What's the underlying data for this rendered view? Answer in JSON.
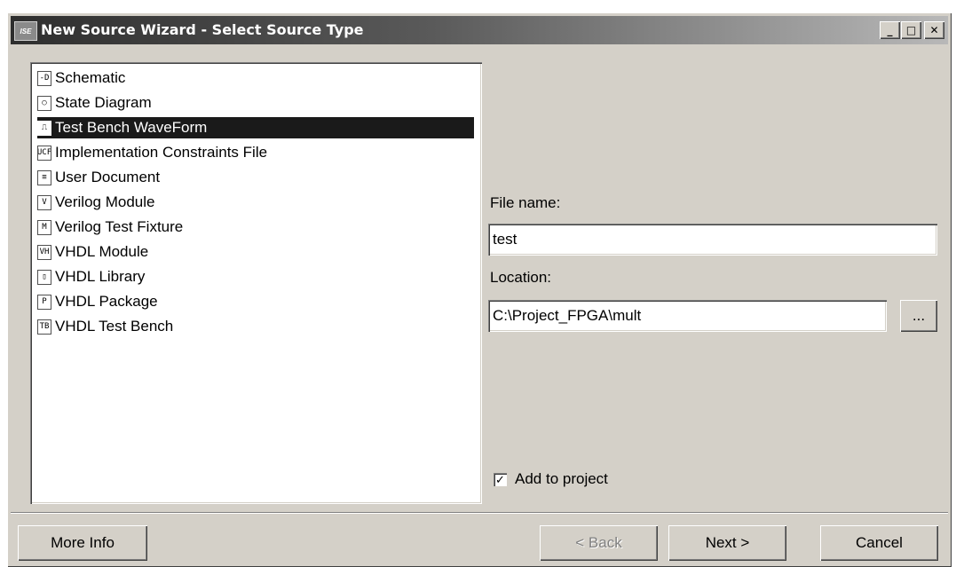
{
  "window": {
    "title": "New Source Wizard - Select Source Type",
    "app_icon_text": "ISE",
    "controls": {
      "minimize": "_",
      "maximize": "□",
      "close": "✕"
    }
  },
  "source_types": [
    {
      "label": "Schematic",
      "icon": "schematic-icon",
      "glyph": "-D",
      "selected": false
    },
    {
      "label": "State Diagram",
      "icon": "state-diagram-icon",
      "glyph": "○",
      "selected": false
    },
    {
      "label": "Test Bench WaveForm",
      "icon": "waveform-icon",
      "glyph": "⎍",
      "selected": true
    },
    {
      "label": "Implementation Constraints File",
      "icon": "constraints-file-icon",
      "glyph": "UCF",
      "selected": false
    },
    {
      "label": "User Document",
      "icon": "document-icon",
      "glyph": "≡",
      "selected": false
    },
    {
      "label": "Verilog Module",
      "icon": "verilog-module-icon",
      "glyph": "V",
      "selected": false
    },
    {
      "label": "Verilog Test Fixture",
      "icon": "verilog-fixture-icon",
      "glyph": "M",
      "selected": false
    },
    {
      "label": "VHDL Module",
      "icon": "vhdl-module-icon",
      "glyph": "VH",
      "selected": false
    },
    {
      "label": "VHDL Library",
      "icon": "vhdl-library-icon",
      "glyph": "▯",
      "selected": false
    },
    {
      "label": "VHDL Package",
      "icon": "vhdl-package-icon",
      "glyph": "P",
      "selected": false
    },
    {
      "label": "VHDL Test Bench",
      "icon": "vhdl-testbench-icon",
      "glyph": "TB",
      "selected": false
    }
  ],
  "form": {
    "file_name_label": "File name:",
    "file_name_value": "test",
    "location_label": "Location:",
    "location_value": "C:\\Project_FPGA\\mult",
    "browse_label": "...",
    "add_to_project_label": "Add to project",
    "add_to_project_checked": true,
    "check_mark": "✓"
  },
  "buttons": {
    "more_info": "More Info",
    "back": "< Back",
    "next": "Next >",
    "cancel": "Cancel"
  }
}
